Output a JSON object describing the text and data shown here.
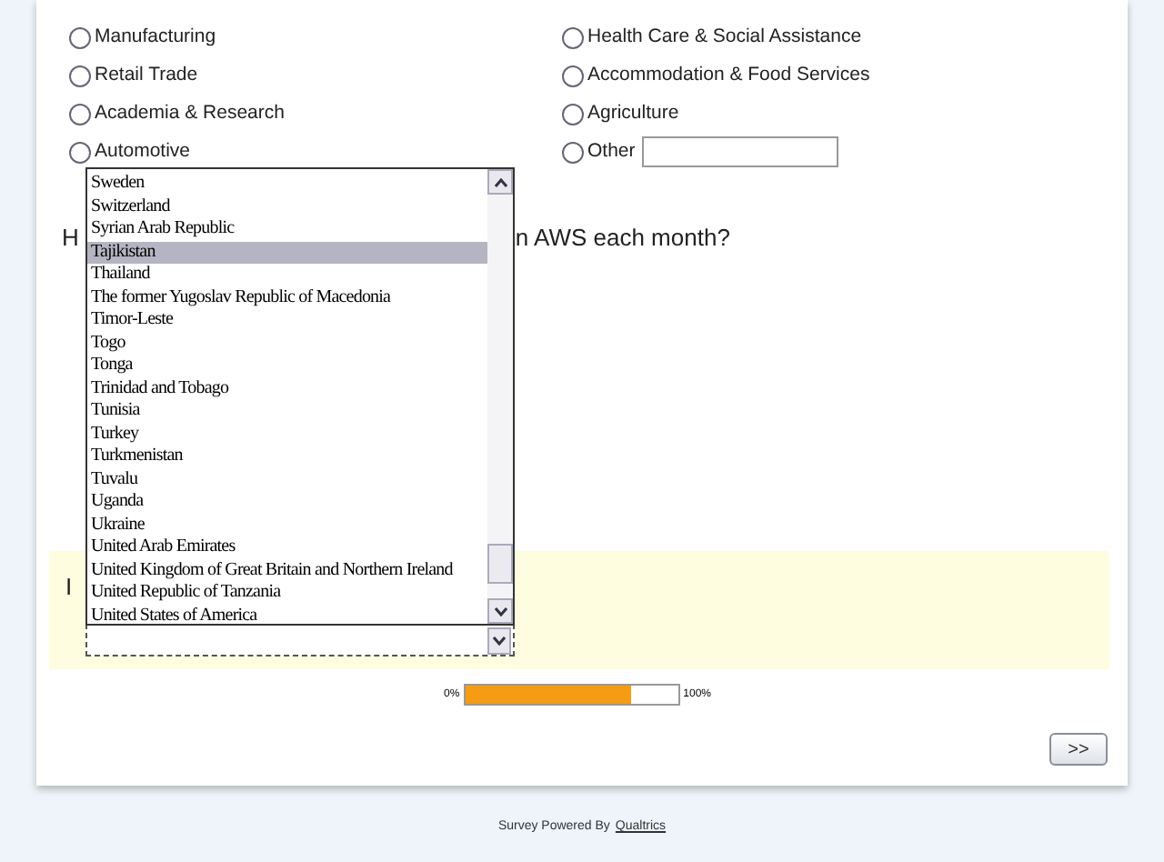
{
  "industry_options": [
    {
      "label": "Manufacturing",
      "selected": false
    },
    {
      "label": "Health Care & Social Assistance",
      "selected": false
    },
    {
      "label": "Retail Trade",
      "selected": false
    },
    {
      "label": "Accommodation & Food Services",
      "selected": false
    },
    {
      "label": "Academia & Research",
      "selected": false
    },
    {
      "label": "Agriculture",
      "selected": false
    },
    {
      "label": "Automotive",
      "selected": false
    },
    {
      "label": "Other",
      "selected": false,
      "kind": "other"
    }
  ],
  "question_fragments": [
    "H",
    "n AWS each month?"
  ],
  "next_question_fragment": "I",
  "country_dropdown": {
    "options": [
      {
        "label": "Sweden",
        "selected": false
      },
      {
        "label": "Switzerland",
        "selected": false
      },
      {
        "label": "Syrian Arab Republic",
        "selected": false
      },
      {
        "label": "Tajikistan",
        "selected": true
      },
      {
        "label": "Thailand",
        "selected": false
      },
      {
        "label": "The former Yugoslav Republic of Macedonia",
        "selected": false
      },
      {
        "label": "Timor-Leste",
        "selected": false
      },
      {
        "label": "Togo",
        "selected": false
      },
      {
        "label": "Tonga",
        "selected": false
      },
      {
        "label": "Trinidad and Tobago",
        "selected": false
      },
      {
        "label": "Tunisia",
        "selected": false
      },
      {
        "label": "Turkey",
        "selected": false
      },
      {
        "label": "Turkmenistan",
        "selected": false
      },
      {
        "label": "Tuvalu",
        "selected": false
      },
      {
        "label": "Uganda",
        "selected": false
      },
      {
        "label": "Ukraine",
        "selected": false
      },
      {
        "label": "United Arab Emirates",
        "selected": false
      },
      {
        "label": "United Kingdom of Great Britain and Northern Ireland",
        "selected": false
      },
      {
        "label": "United Republic of Tanzania",
        "selected": false
      },
      {
        "label": "United States of America",
        "selected": false
      }
    ]
  },
  "progress": {
    "start_label": "0%",
    "end_label": "100%",
    "level": 0.78
  },
  "next_button": ">>",
  "footer": {
    "text": "Survey Powered By",
    "link": "Qualtrics"
  }
}
